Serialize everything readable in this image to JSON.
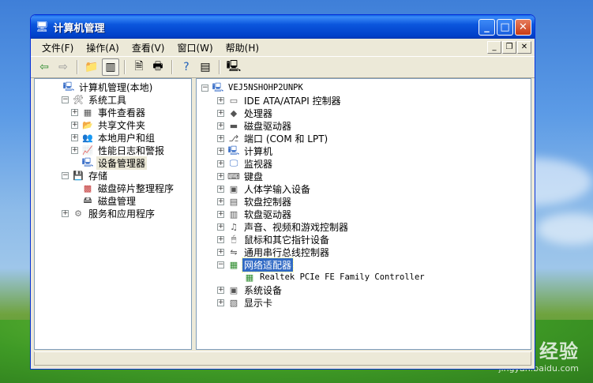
{
  "window": {
    "title": "计算机管理"
  },
  "menubar": {
    "items": [
      "文件(F)",
      "操作(A)",
      "查看(V)",
      "窗口(W)",
      "帮助(H)"
    ]
  },
  "left_tree": [
    {
      "label": "计算机管理(本地)",
      "level": 0,
      "expander": "none",
      "icon": "computer-icon"
    },
    {
      "label": "系统工具",
      "level": 1,
      "expander": "minus",
      "icon": "tools-icon"
    },
    {
      "label": "事件查看器",
      "level": 2,
      "expander": "plus",
      "icon": "event-viewer-icon"
    },
    {
      "label": "共享文件夹",
      "level": 2,
      "expander": "plus",
      "icon": "shared-folder-icon"
    },
    {
      "label": "本地用户和组",
      "level": 2,
      "expander": "plus",
      "icon": "users-icon"
    },
    {
      "label": "性能日志和警报",
      "level": 2,
      "expander": "plus",
      "icon": "performance-icon"
    },
    {
      "label": "设备管理器",
      "level": 2,
      "expander": "none",
      "icon": "device-manager-icon",
      "selected": true
    },
    {
      "label": "存储",
      "level": 1,
      "expander": "minus",
      "icon": "storage-icon"
    },
    {
      "label": "磁盘碎片整理程序",
      "level": 2,
      "expander": "none",
      "icon": "defrag-icon"
    },
    {
      "label": "磁盘管理",
      "level": 2,
      "expander": "none",
      "icon": "disk-management-icon"
    },
    {
      "label": "服务和应用程序",
      "level": 1,
      "expander": "plus",
      "icon": "services-icon"
    }
  ],
  "right_tree": [
    {
      "label": "VEJ5NSHOHP2UNPK",
      "level": 0,
      "expander": "minus",
      "icon": "computer-icon",
      "mono": true
    },
    {
      "label": "IDE ATA/ATAPI 控制器",
      "level": 1,
      "expander": "plus",
      "icon": "ide-controller-icon"
    },
    {
      "label": "处理器",
      "level": 1,
      "expander": "plus",
      "icon": "processor-icon"
    },
    {
      "label": "磁盘驱动器",
      "level": 1,
      "expander": "plus",
      "icon": "disk-drive-icon"
    },
    {
      "label": "端口 (COM 和 LPT)",
      "level": 1,
      "expander": "plus",
      "icon": "port-icon"
    },
    {
      "label": "计算机",
      "level": 1,
      "expander": "plus",
      "icon": "computer-icon"
    },
    {
      "label": "监视器",
      "level": 1,
      "expander": "plus",
      "icon": "monitor-icon"
    },
    {
      "label": "键盘",
      "level": 1,
      "expander": "plus",
      "icon": "keyboard-icon"
    },
    {
      "label": "人体学输入设备",
      "level": 1,
      "expander": "plus",
      "icon": "hid-icon"
    },
    {
      "label": "软盘控制器",
      "level": 1,
      "expander": "plus",
      "icon": "floppy-controller-icon"
    },
    {
      "label": "软盘驱动器",
      "level": 1,
      "expander": "plus",
      "icon": "floppy-drive-icon"
    },
    {
      "label": "声音、视频和游戏控制器",
      "level": 1,
      "expander": "plus",
      "icon": "sound-icon"
    },
    {
      "label": "鼠标和其它指针设备",
      "level": 1,
      "expander": "plus",
      "icon": "mouse-icon"
    },
    {
      "label": "通用串行总线控制器",
      "level": 1,
      "expander": "plus",
      "icon": "usb-icon"
    },
    {
      "label": "网络适配器",
      "level": 1,
      "expander": "minus",
      "icon": "network-adapter-icon",
      "selected": true
    },
    {
      "label": "Realtek PCIe FE Family Controller",
      "level": 2,
      "expander": "none",
      "icon": "network-card-icon",
      "mono": true
    },
    {
      "label": "系统设备",
      "level": 1,
      "expander": "plus",
      "icon": "system-device-icon"
    },
    {
      "label": "显示卡",
      "level": 1,
      "expander": "plus",
      "icon": "display-adapter-icon"
    }
  ],
  "watermark": {
    "main": "Baidu 经验",
    "sub": "jingyan.baidu.com"
  }
}
